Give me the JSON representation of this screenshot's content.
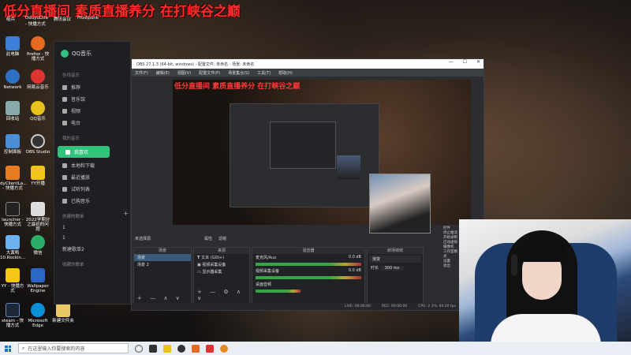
{
  "stream_banner": "低分直播间 素质直播养分 在打峡谷之巅",
  "desktop": {
    "top_labels": [
      "组兵",
      "DouyuLive - 快播方式",
      "腾讯会议",
      "Frostpunk"
    ],
    "icons": [
      {
        "label": "此电脑",
        "color": "#3c7fd8"
      },
      {
        "label": "firefox - 快播方式",
        "color": "#e66a1f"
      },
      {
        "label": "Network",
        "color": "#2f6fc2"
      },
      {
        "label": "网易云音乐",
        "color": "#d33"
      },
      {
        "label": "回收站",
        "color": "#8aa"
      },
      {
        "label": "QQ音乐",
        "color": "#e8c21a"
      },
      {
        "label": "控制面板",
        "color": "#4a8fd8"
      },
      {
        "label": "OBS Studio",
        "color": "#333"
      },
      {
        "label": "dyClientLa... - 快播方式",
        "color": "#e77c21"
      },
      {
        "label": "YY开播",
        "color": "#f0c419"
      },
      {
        "label": "launcher - 快播方式",
        "color": "#222"
      },
      {
        "label": "2022学期分之最初的问题",
        "color": "#ddd"
      },
      {
        "label": "大黄鸭 10.Rockin...",
        "color": "#6bb3f0"
      },
      {
        "label": "微信",
        "color": "#2aae67"
      },
      {
        "label": "YY - 快播方式",
        "color": "#f5c518"
      },
      {
        "label": "Wallpaper Engine",
        "color": "#2c66c7"
      },
      {
        "label": "steam - 快播方式",
        "color": "#1b2838"
      },
      {
        "label": "Microsoft Edge",
        "color": "#0c8fd4"
      },
      {
        "label": "新建文件夹",
        "color": "#e8c766"
      }
    ]
  },
  "qq_music": {
    "app_name": "QQ音乐",
    "online_section": "在线音乐",
    "online_items": [
      "推荐",
      "音乐馆",
      "视频",
      "电台"
    ],
    "mine_section": "我的音乐",
    "mine_items": [
      "我喜欢",
      "本地和下载",
      "最近播放",
      "试听列表",
      "已购音乐"
    ],
    "created_section": "创建的歌单",
    "created_items": [
      "1",
      "1",
      "新建歌单2"
    ],
    "collected_section": "收藏的歌单",
    "plus": "+"
  },
  "obs": {
    "title": "OBS 27.1.3 (64-bit, windows) - 配置文件: 未命名 - 场景: 未命名",
    "menu": [
      "文件(F)",
      "编辑(E)",
      "视图(V)",
      "配置文件(P)",
      "场景集合(S)",
      "工具(T)",
      "帮助(H)"
    ],
    "controls": [
      "—",
      "☐",
      "✕"
    ],
    "below_preview": [
      "未选择源",
      "属性",
      "滤镜"
    ],
    "scenes_header": "场景",
    "scenes": [
      "场景",
      "场景 2"
    ],
    "sources_header": "来源",
    "sources": [
      "文本 (GDI+)",
      "视频采集设备",
      "显示器采集"
    ],
    "mixer_header": "混音器",
    "mixer": [
      {
        "name": "麦克风/Aux",
        "db": "0.0 dB"
      },
      {
        "name": "视频采集设备",
        "db": "0.0 dB"
      },
      {
        "name": "桌面音频",
        "db": "0.0 dB"
      }
    ],
    "transitions_header": "转场特效",
    "transition_type": "渐变",
    "duration_label": "时长",
    "duration_value": "300 ms",
    "controls_header": "控件",
    "control_buttons": [
      "停止推流",
      "开始录制",
      "启动虚拟摄像机",
      "工作室模式",
      "设置",
      "退出"
    ],
    "status": [
      "LIVE: 00:00:00",
      "REC: 00:00:00",
      "CPU: 2.3%, 60.00 fps"
    ],
    "panel_buttons": "+ — ∧ ∨",
    "source_buttons": "+ — ⚙ ∧ ∨"
  },
  "taskbar": {
    "search_placeholder": "在这里输入你要搜索的内容",
    "icon_colors": [
      "#555",
      "#333",
      "#e8c21a",
      "#333",
      "#e66a1f",
      "#d33",
      "#e08a22"
    ]
  }
}
